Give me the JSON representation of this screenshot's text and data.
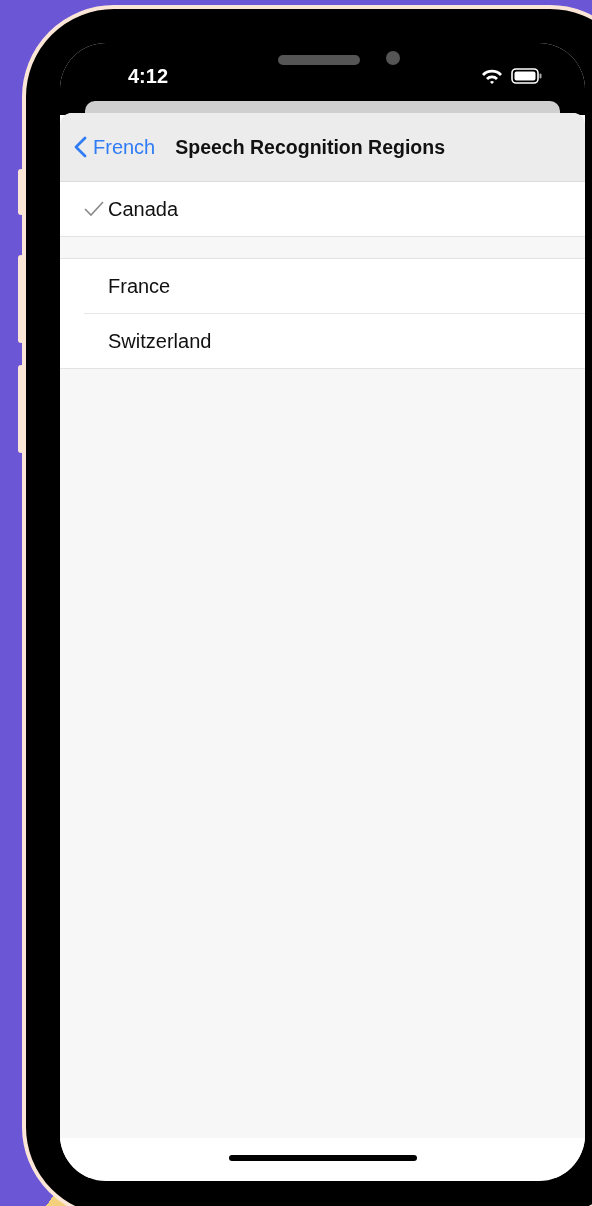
{
  "status_bar": {
    "time": "4:12"
  },
  "nav_bar": {
    "back_label": "French",
    "title": "Speech Recognition Regions"
  },
  "sections": [
    [
      {
        "label": "Canada",
        "selected": true
      }
    ],
    [
      {
        "label": "France",
        "selected": false
      },
      {
        "label": "Switzerland",
        "selected": false
      }
    ]
  ]
}
